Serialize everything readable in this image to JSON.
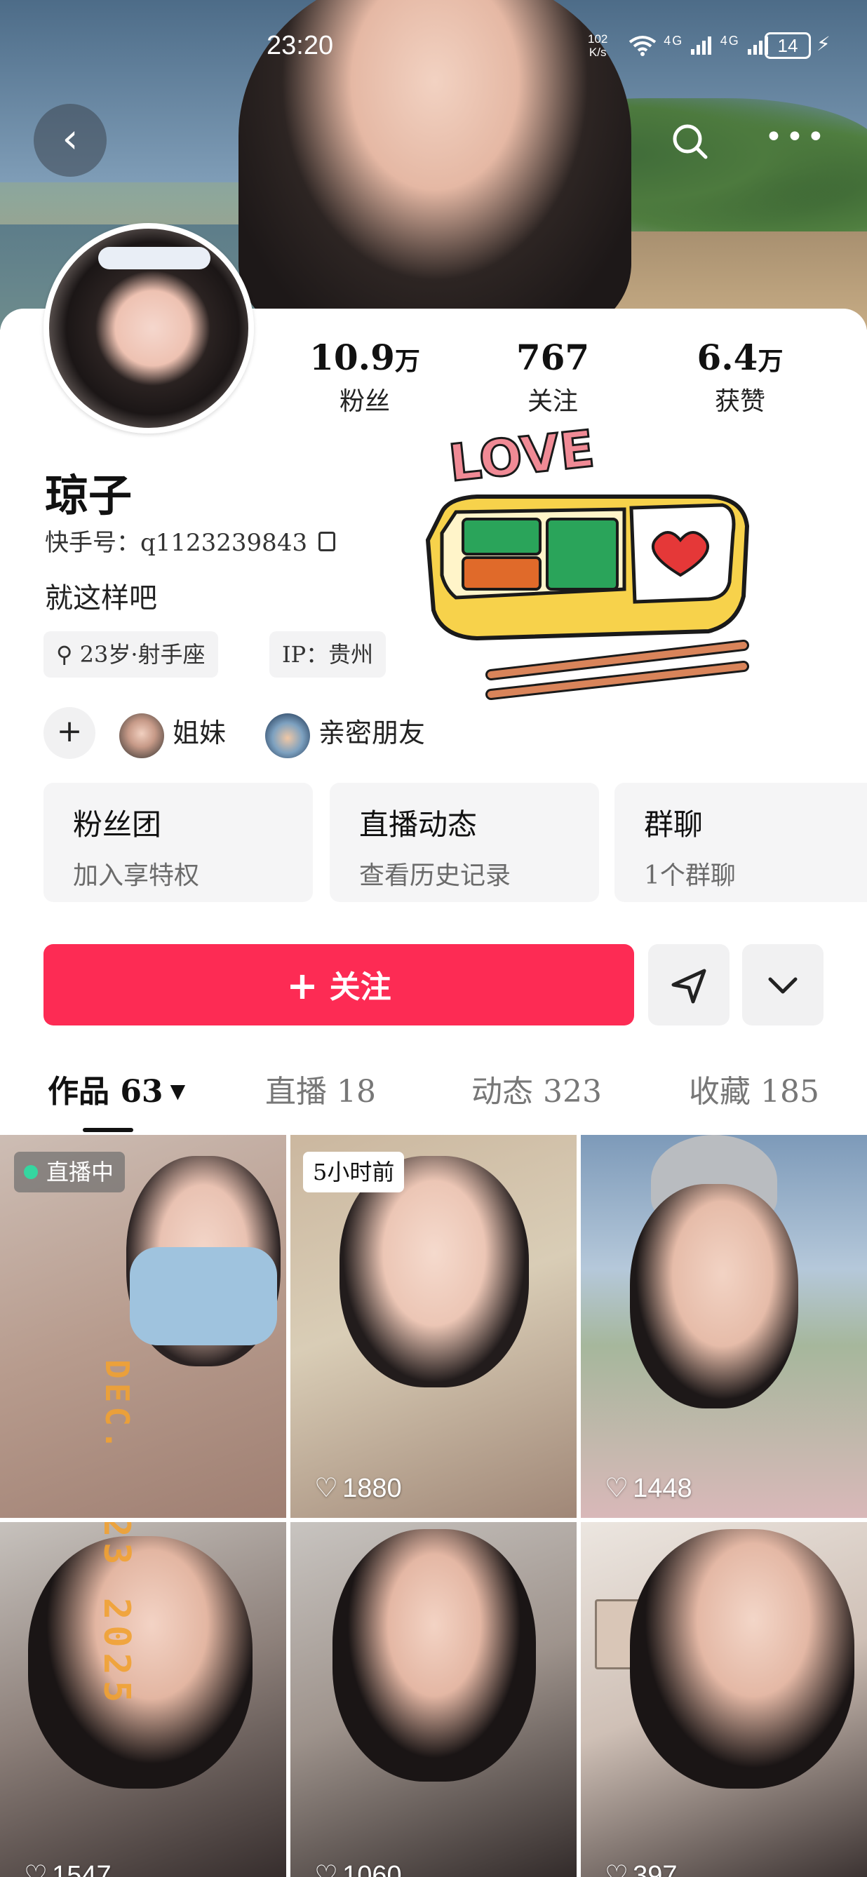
{
  "status_bar": {
    "time": "23:20",
    "net_speed_value": "102",
    "net_speed_unit": "K/s",
    "signal_text": "4G",
    "battery": "14"
  },
  "header": {
    "back_icon": "chevron-left-icon",
    "search_icon": "search-icon",
    "more_icon": "more-horizontal-icon"
  },
  "profile": {
    "stats": [
      {
        "value": "10.9",
        "unit": "万",
        "label": "粉丝"
      },
      {
        "value": "767",
        "unit": "",
        "label": "关注"
      },
      {
        "value": "6.4",
        "unit": "万",
        "label": "获赞"
      }
    ],
    "name": "琼子",
    "kuaishou_id": "快手号：q1123239843",
    "bio": "就这样吧",
    "tags": {
      "age": "23岁·射手座",
      "ip": "IP：贵州"
    },
    "relations": [
      {
        "label": "姐妹"
      },
      {
        "label": "亲密朋友"
      }
    ],
    "sticker_text": "LOVE"
  },
  "quick_cards": [
    {
      "title": "粉丝团",
      "subtitle": "加入享特权"
    },
    {
      "title": "直播动态",
      "subtitle": "查看历史记录"
    },
    {
      "title": "群聊",
      "subtitle": "1个群聊"
    }
  ],
  "actions": {
    "follow_label": "关注",
    "follow_plus": "+"
  },
  "tabs": [
    {
      "label": "作品 63"
    },
    {
      "label": "直播 18"
    },
    {
      "label": "动态 323"
    },
    {
      "label": "收藏 185"
    }
  ],
  "grid": {
    "tiles": [
      {
        "badge": "直播中",
        "likes": ""
      },
      {
        "badge": "5小时前",
        "likes": "1880"
      },
      {
        "badge": "",
        "likes": "1448"
      },
      {
        "badge": "",
        "likes": "1547"
      },
      {
        "badge": "",
        "likes": "1060"
      },
      {
        "badge": "",
        "likes": "397"
      }
    ],
    "overlay_text_1": "DEC.",
    "overlay_text_2": "23 2025"
  },
  "colors": {
    "accent": "#fd2b54",
    "live_dot": "#35d6a0",
    "chip_bg": "#f3f3f4"
  }
}
